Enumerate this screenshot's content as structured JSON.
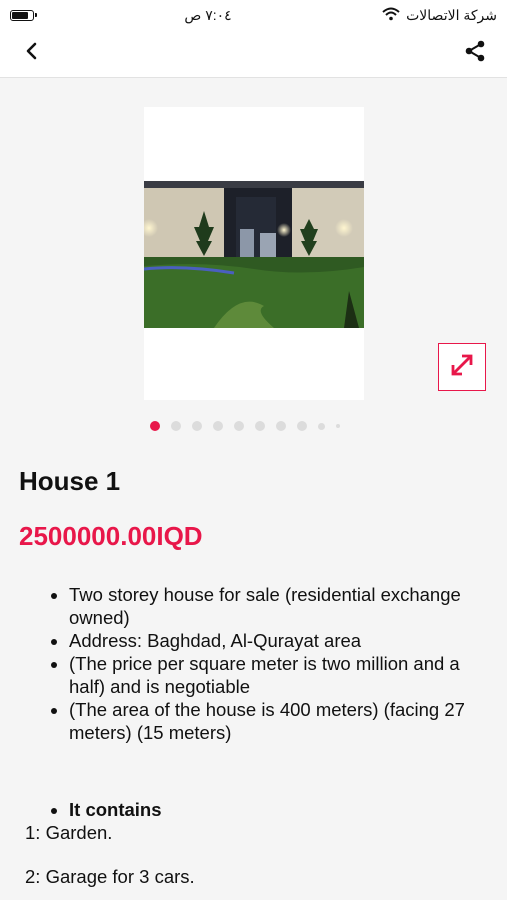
{
  "status_bar": {
    "carrier": "شركة الاتصالات",
    "time": "٧:٠٤ ص",
    "battery_level": 0.9
  },
  "nav": {
    "back_icon": "chevron-left-icon",
    "share_icon": "share-icon"
  },
  "gallery": {
    "total_images": 10,
    "active_index": 0,
    "expand_icon": "expand-icon",
    "accent_color": "#e8174a"
  },
  "listing": {
    "title": "House 1",
    "price": "2500000.00IQD",
    "bullets": [
      "Two storey house for sale (residential exchange owned)",
      "Address: Baghdad, Al-Qurayat area",
      "(The price per square meter is two million and a half) and is negotiable",
      "(The area of the house is 400 meters) (facing 27 meters) (15 meters)"
    ],
    "contains_heading": "It contains",
    "contains_items": [
      "1: Garden.",
      "2: Garage for 3 cars."
    ]
  }
}
